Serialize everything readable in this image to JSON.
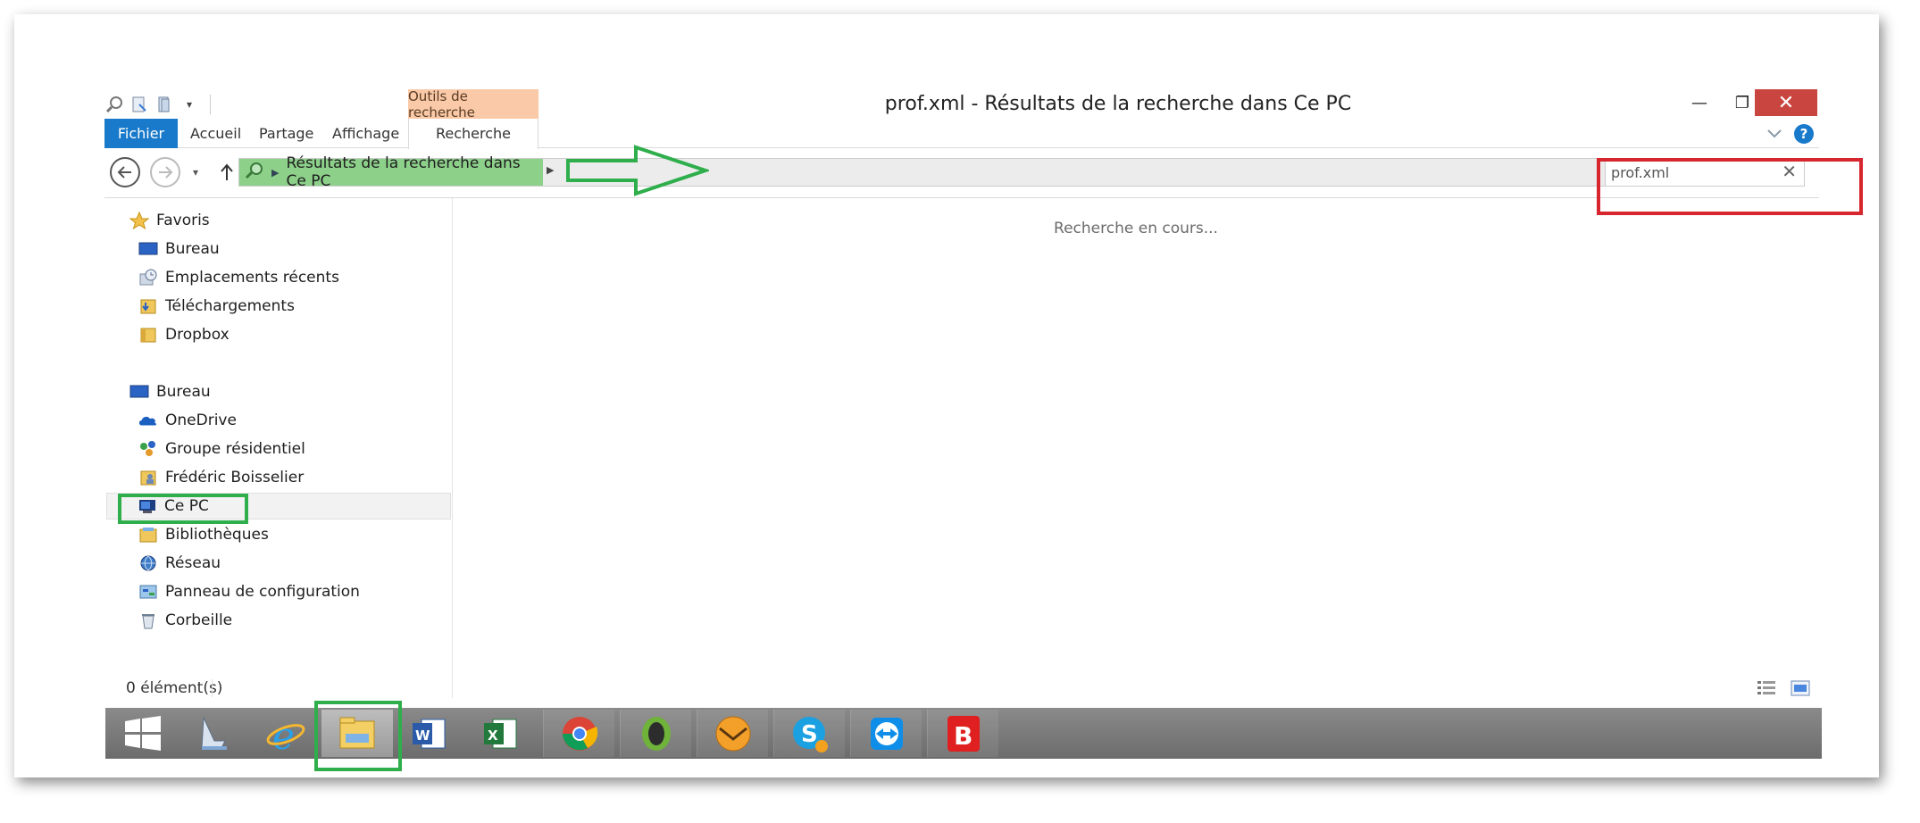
{
  "window": {
    "title": "prof.xml - Résultats de la recherche dans Ce PC",
    "tools_tab": "Outils de recherche",
    "close_glyph": "✕",
    "minimize_glyph": "—",
    "maximize_glyph": "❐"
  },
  "ribbon": {
    "file": "Fichier",
    "accueil": "Accueil",
    "partage": "Partage",
    "affichage": "Affichage",
    "recherche": "Recherche",
    "help": "?"
  },
  "address": {
    "breadcrumb": "Résultats de la recherche dans Ce PC",
    "search_value": "prof.xml"
  },
  "sidebar": {
    "favorites_header": "Favoris",
    "favorites": [
      {
        "label": "Bureau",
        "icon": "desktop-icon"
      },
      {
        "label": "Emplacements récents",
        "icon": "recent-places-icon"
      },
      {
        "label": "Téléchargements",
        "icon": "downloads-folder-icon"
      },
      {
        "label": "Dropbox",
        "icon": "dropbox-folder-icon"
      }
    ],
    "desktop_header": "Bureau",
    "desktop_items": [
      {
        "label": "OneDrive",
        "icon": "onedrive-icon"
      },
      {
        "label": "Groupe résidentiel",
        "icon": "homegroup-icon"
      },
      {
        "label": "Frédéric Boisselier",
        "icon": "user-folder-icon"
      },
      {
        "label": "Ce PC",
        "icon": "computer-icon"
      },
      {
        "label": "Bibliothèques",
        "icon": "libraries-icon"
      },
      {
        "label": "Réseau",
        "icon": "network-icon"
      },
      {
        "label": "Panneau de configuration",
        "icon": "control-panel-icon"
      },
      {
        "label": "Corbeille",
        "icon": "recycle-bin-icon"
      }
    ]
  },
  "content": {
    "searching_text": "Recherche en cours..."
  },
  "status": {
    "count": "0 élément(s)"
  },
  "taskbar": {
    "items": [
      "start",
      "scanner",
      "internet-explorer",
      "file-explorer",
      "word",
      "excel",
      "chrome",
      "app-o",
      "emclient",
      "skype",
      "teamviewer",
      "bitdefender"
    ]
  },
  "colors": {
    "file_tab": "#1979ca",
    "tools_tab": "#f9c9a8",
    "breadcrumb_green": "#8dd08a",
    "close_red": "#c9453f",
    "annotation_red": "#d7262e",
    "annotation_green": "#2fae4c"
  }
}
